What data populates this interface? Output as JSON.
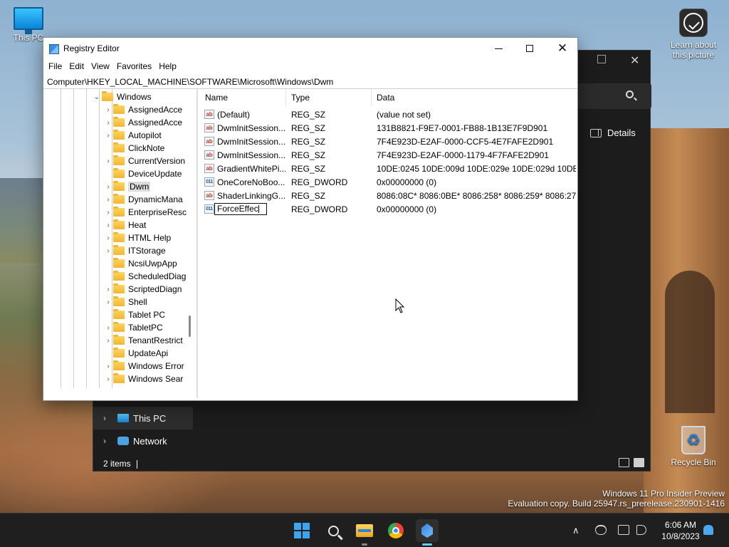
{
  "desktop": {
    "icons": {
      "this_pc": "This PC",
      "learn": "Learn about this picture",
      "recycle": "Recycle Bin"
    },
    "watermark": {
      "line1": "Windows 11 Pro Insider Preview",
      "line2": "Evaluation copy. Build 25947.rs_prerelease.230901-1416"
    }
  },
  "explorer": {
    "details_label": "Details",
    "nav": [
      {
        "label": "This PC",
        "icon": "monitor-icon"
      },
      {
        "label": "Network",
        "icon": "network-icon"
      }
    ],
    "status": "2 items"
  },
  "regedit": {
    "title": "Registry Editor",
    "menu": [
      "File",
      "Edit",
      "View",
      "Favorites",
      "Help"
    ],
    "address": "Computer\\HKEY_LOCAL_MACHINE\\SOFTWARE\\Microsoft\\Windows\\Dwm",
    "tree": [
      "Windows",
      "AssignedAcce",
      "AssignedAcce",
      "Autopilot",
      "ClickNote",
      "CurrentVersion",
      "DeviceUpdate",
      "Dwm",
      "DynamicMana",
      "EnterpriseResc",
      "Heat",
      "HTML Help",
      "ITStorage",
      "NcsiUwpApp",
      "ScheduledDiag",
      "ScriptedDiagn",
      "Shell",
      "Tablet PC",
      "TabletPC",
      "TenantRestrict",
      "UpdateApi",
      "Windows Error",
      "Windows Sear"
    ],
    "columns": {
      "name": "Name",
      "type": "Type",
      "data": "Data"
    },
    "values": [
      {
        "name": "(Default)",
        "type": "REG_SZ",
        "data": "(value not set)",
        "kind": "string"
      },
      {
        "name": "DwmInitSession...",
        "type": "REG_SZ",
        "data": "131B8821-F9E7-0001-FB88-1B13E7F9D901",
        "kind": "string"
      },
      {
        "name": "DwmInitSession...",
        "type": "REG_SZ",
        "data": "7F4E923D-E2AF-0000-CCF5-4E7FAFE2D901",
        "kind": "string"
      },
      {
        "name": "DwmInitSession...",
        "type": "REG_SZ",
        "data": "7F4E923D-E2AF-0000-1179-4F7FAFE2D901",
        "kind": "string"
      },
      {
        "name": "GradientWhitePi...",
        "type": "REG_SZ",
        "data": "10DE:0245 10DE:009d 10DE:029e 10DE:029d 10DE:02...",
        "kind": "string"
      },
      {
        "name": "OneCoreNoBoo...",
        "type": "REG_DWORD",
        "data": "0x00000000 (0)",
        "kind": "dword"
      },
      {
        "name": "ShaderLinkingG...",
        "type": "REG_SZ",
        "data": "8086:08C* 8086:0BE* 8086:258* 8086:259* 8086:277*...",
        "kind": "string"
      },
      {
        "name": "ForceEffec",
        "type": "REG_DWORD",
        "data": "0x00000000 (0)",
        "kind": "dword",
        "renaming": true
      }
    ],
    "icon_text": {
      "string": "ab",
      "dword": "011"
    }
  },
  "taskbar": {
    "time": "6:06 AM",
    "date": "10/8/2023",
    "apps": [
      "Start",
      "Search",
      "File Explorer",
      "Google Chrome",
      "Registry Editor"
    ]
  }
}
